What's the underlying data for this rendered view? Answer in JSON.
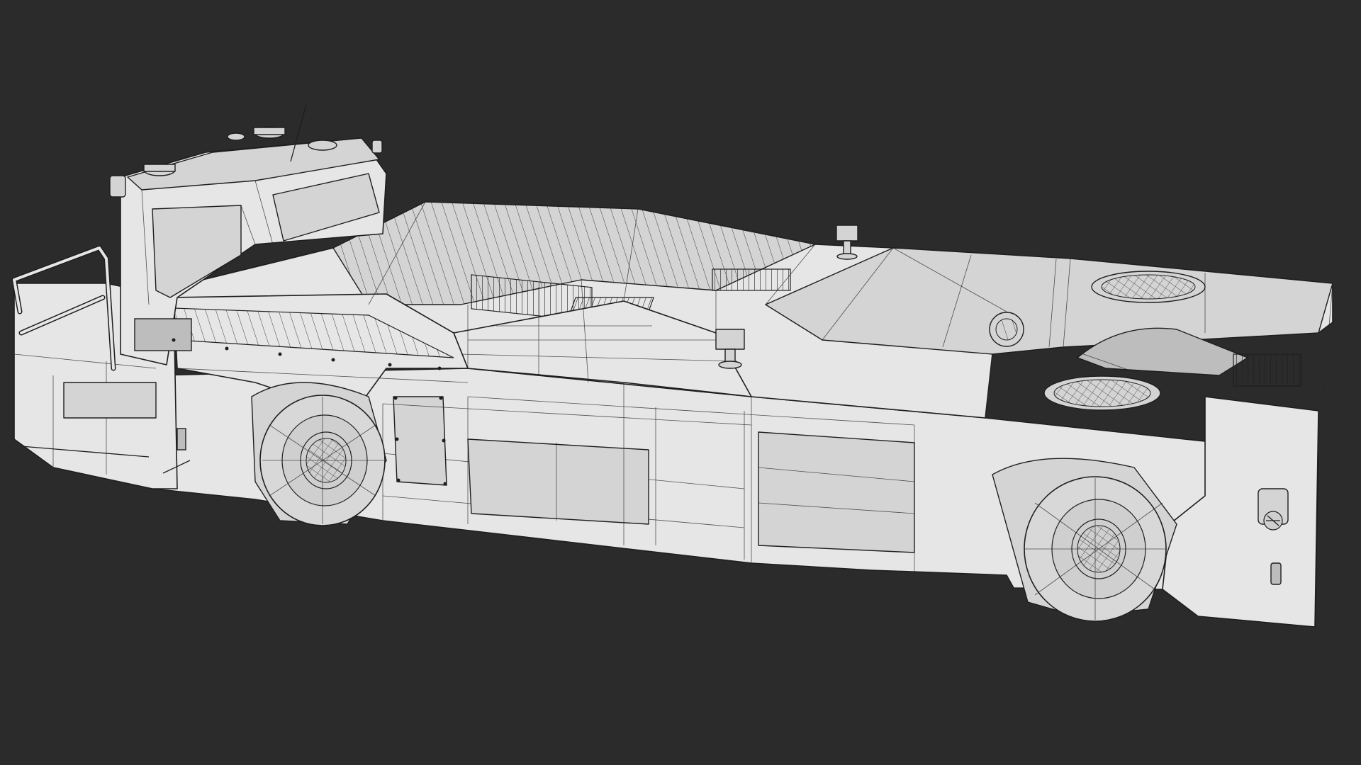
{
  "scene": {
    "caption": "",
    "background_color": "#2b2b2b",
    "model_color": "#e6e6e6",
    "wire_color": "#1e1e1e"
  }
}
